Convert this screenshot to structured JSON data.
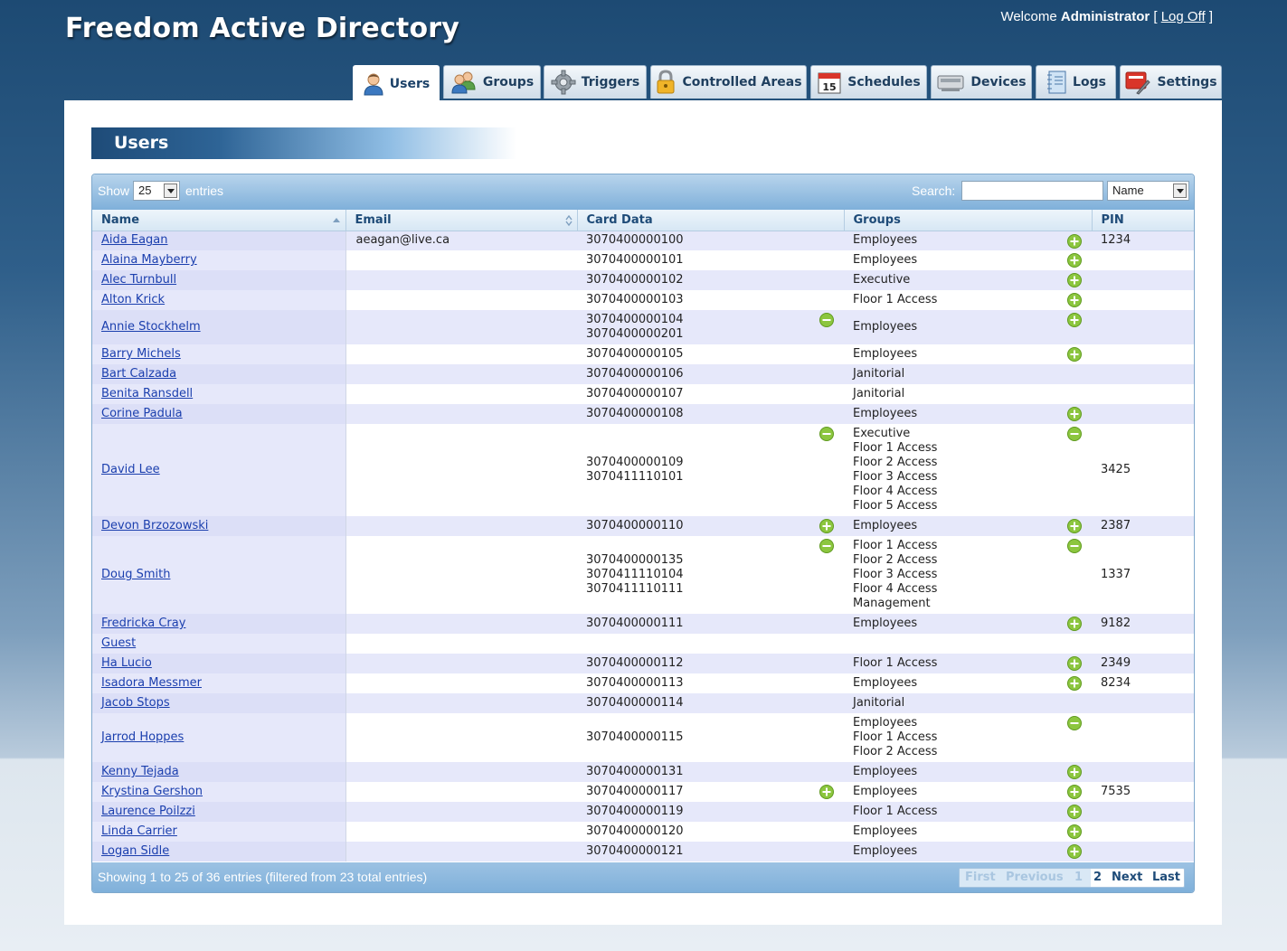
{
  "header": {
    "title": "Freedom Active Directory",
    "welcome_prefix": "Welcome ",
    "user": "Administrator",
    "bracket_open": " [ ",
    "logoff": "Log Off",
    "bracket_close": " ]"
  },
  "tabs": [
    {
      "label": "Users",
      "icon": "users-icon",
      "active": true
    },
    {
      "label": "Groups",
      "icon": "groups-icon",
      "active": false
    },
    {
      "label": "Triggers",
      "icon": "gear-icon",
      "active": false
    },
    {
      "label": "Controlled Areas",
      "icon": "padlock-icon",
      "active": false
    },
    {
      "label": "Schedules",
      "icon": "calendar-icon",
      "active": false
    },
    {
      "label": "Devices",
      "icon": "device-icon",
      "active": false
    },
    {
      "label": "Logs",
      "icon": "notebook-icon",
      "active": false
    },
    {
      "label": "Settings",
      "icon": "settings-icon",
      "active": false
    }
  ],
  "calendar_day": "15",
  "page": {
    "title": "Users"
  },
  "toolbar": {
    "show": "Show",
    "page_size": "25",
    "entries": "entries",
    "search_label": "Search:",
    "search_value": "",
    "search_field": "Name"
  },
  "columns": [
    "Name",
    "Email",
    "Card Data",
    "Groups",
    "PIN"
  ],
  "rows": [
    {
      "name": "Aida Eagan",
      "email": "aeagan@live.ca",
      "cards": [
        "3070400000100"
      ],
      "card_icon": "",
      "groups": [
        "Employees"
      ],
      "group_icon": "add",
      "pin": "1234"
    },
    {
      "name": "Alaina Mayberry",
      "email": "",
      "cards": [
        "3070400000101"
      ],
      "card_icon": "",
      "groups": [
        "Employees"
      ],
      "group_icon": "add",
      "pin": ""
    },
    {
      "name": "Alec Turnbull",
      "email": "",
      "cards": [
        "3070400000102"
      ],
      "card_icon": "",
      "groups": [
        "Executive"
      ],
      "group_icon": "add",
      "pin": ""
    },
    {
      "name": "Alton Krick",
      "email": "",
      "cards": [
        "3070400000103"
      ],
      "card_icon": "",
      "groups": [
        "Floor 1 Access"
      ],
      "group_icon": "add",
      "pin": ""
    },
    {
      "name": "Annie Stockhelm",
      "email": "",
      "cards": [
        "3070400000104",
        "3070400000201"
      ],
      "card_icon": "remove",
      "groups": [
        "Employees"
      ],
      "group_icon": "add",
      "pin": ""
    },
    {
      "name": "Barry Michels",
      "email": "",
      "cards": [
        "3070400000105"
      ],
      "card_icon": "",
      "groups": [
        "Employees"
      ],
      "group_icon": "add",
      "pin": ""
    },
    {
      "name": "Bart Calzada",
      "email": "",
      "cards": [
        "3070400000106"
      ],
      "card_icon": "",
      "groups": [
        "Janitorial"
      ],
      "group_icon": "",
      "pin": ""
    },
    {
      "name": "Benita Ransdell",
      "email": "",
      "cards": [
        "3070400000107"
      ],
      "card_icon": "",
      "groups": [
        "Janitorial"
      ],
      "group_icon": "",
      "pin": ""
    },
    {
      "name": "Corine Padula",
      "email": "",
      "cards": [
        "3070400000108"
      ],
      "card_icon": "",
      "groups": [
        "Employees"
      ],
      "group_icon": "add",
      "pin": ""
    },
    {
      "name": "David Lee",
      "email": "",
      "cards": [
        "3070400000109",
        "3070411110101"
      ],
      "card_icon": "remove",
      "groups": [
        "Executive",
        "Floor 1 Access",
        "Floor 2 Access",
        "Floor 3 Access",
        "Floor 4 Access",
        "Floor 5 Access"
      ],
      "group_icon": "remove",
      "pin": "3425"
    },
    {
      "name": "Devon Brzozowski",
      "email": "",
      "cards": [
        "3070400000110"
      ],
      "card_icon": "add",
      "groups": [
        "Employees"
      ],
      "group_icon": "add",
      "pin": "2387"
    },
    {
      "name": "Doug Smith",
      "email": "",
      "cards": [
        "3070400000135",
        "3070411110104",
        "3070411110111"
      ],
      "card_icon": "remove",
      "groups": [
        "Floor 1 Access",
        "Floor 2 Access",
        "Floor 3 Access",
        "Floor 4 Access",
        "Management"
      ],
      "group_icon": "remove",
      "pin": "1337"
    },
    {
      "name": "Fredricka Cray",
      "email": "",
      "cards": [
        "3070400000111"
      ],
      "card_icon": "",
      "groups": [
        "Employees"
      ],
      "group_icon": "add",
      "pin": "9182"
    },
    {
      "name": "Guest",
      "email": "",
      "cards": [],
      "card_icon": "",
      "groups": [],
      "group_icon": "",
      "pin": ""
    },
    {
      "name": "Ha Lucio",
      "email": "",
      "cards": [
        "3070400000112"
      ],
      "card_icon": "",
      "groups": [
        "Floor 1 Access"
      ],
      "group_icon": "add",
      "pin": "2349"
    },
    {
      "name": "Isadora Messmer",
      "email": "",
      "cards": [
        "3070400000113"
      ],
      "card_icon": "",
      "groups": [
        "Employees"
      ],
      "group_icon": "add",
      "pin": "8234"
    },
    {
      "name": "Jacob Stops",
      "email": "",
      "cards": [
        "3070400000114"
      ],
      "card_icon": "",
      "groups": [
        "Janitorial"
      ],
      "group_icon": "",
      "pin": ""
    },
    {
      "name": "Jarrod Hoppes",
      "email": "",
      "cards": [
        "3070400000115"
      ],
      "card_icon": "",
      "groups": [
        "Employees",
        "Floor 1 Access",
        "Floor 2 Access"
      ],
      "group_icon": "remove",
      "pin": ""
    },
    {
      "name": "Kenny Tejada",
      "email": "",
      "cards": [
        "3070400000131"
      ],
      "card_icon": "",
      "groups": [
        "Employees"
      ],
      "group_icon": "add",
      "pin": ""
    },
    {
      "name": "Krystina Gershon",
      "email": "",
      "cards": [
        "3070400000117"
      ],
      "card_icon": "add",
      "groups": [
        "Employees"
      ],
      "group_icon": "add",
      "pin": "7535"
    },
    {
      "name": "Laurence Poilzzi",
      "email": "",
      "cards": [
        "3070400000119"
      ],
      "card_icon": "",
      "groups": [
        "Floor 1 Access"
      ],
      "group_icon": "add",
      "pin": ""
    },
    {
      "name": "Linda Carrier",
      "email": "",
      "cards": [
        "3070400000120"
      ],
      "card_icon": "",
      "groups": [
        "Employees"
      ],
      "group_icon": "add",
      "pin": ""
    },
    {
      "name": "Logan Sidle",
      "email": "",
      "cards": [
        "3070400000121"
      ],
      "card_icon": "",
      "groups": [
        "Employees"
      ],
      "group_icon": "add",
      "pin": ""
    }
  ],
  "footer": {
    "info": "Showing 1 to 25 of 36 entries (filtered from 23 total entries)",
    "pager": {
      "first": "First",
      "previous": "Previous",
      "page1": "1",
      "page2": "2",
      "next": "Next",
      "last": "Last"
    }
  },
  "colors": {
    "add_icon": "#8cc63f",
    "remove_icon": "#8cc63f",
    "link": "#1b3fae",
    "header_bg": "#1d4a73"
  }
}
